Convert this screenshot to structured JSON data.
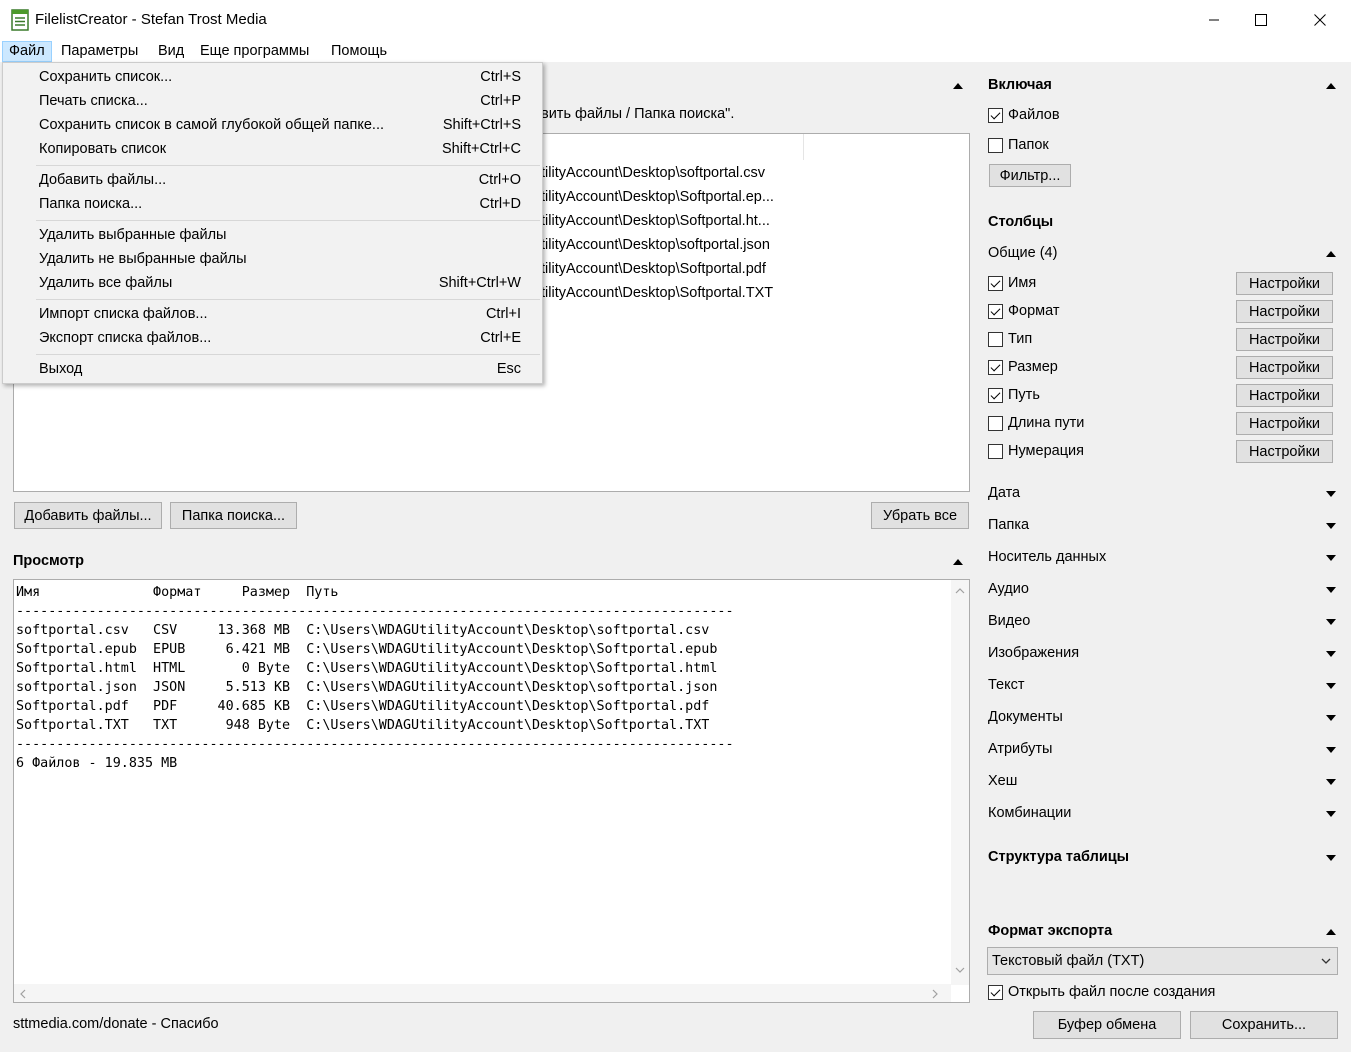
{
  "window": {
    "title": "FilelistCreator - Stefan Trost Media"
  },
  "menubar": [
    "Файл",
    "Параметры",
    "Вид",
    "Еще программы",
    "Помощь"
  ],
  "file_menu": {
    "groups": [
      [
        {
          "label": "Сохранить список...",
          "shortcut": "Ctrl+S"
        },
        {
          "label": "Печать списка...",
          "shortcut": "Ctrl+P"
        },
        {
          "label": "Сохранить список в самой глубокой общей папке...",
          "shortcut": "Shift+Ctrl+S"
        },
        {
          "label": "Копировать список",
          "shortcut": "Shift+Ctrl+C"
        }
      ],
      [
        {
          "label": "Добавить файлы...",
          "shortcut": "Ctrl+O"
        },
        {
          "label": "Папка поиска...",
          "shortcut": "Ctrl+D"
        }
      ],
      [
        {
          "label": "Удалить выбранные файлы",
          "shortcut": ""
        },
        {
          "label": "Удалить не выбранные файлы",
          "shortcut": ""
        },
        {
          "label": "Удалить все файлы",
          "shortcut": "Shift+Ctrl+W"
        }
      ],
      [
        {
          "label": "Импорт списка файлов...",
          "shortcut": "Ctrl+I"
        },
        {
          "label": "Экспорт списка файлов...",
          "shortcut": "Ctrl+E"
        }
      ],
      [
        {
          "label": "Выход",
          "shortcut": "Esc"
        }
      ]
    ]
  },
  "files_panel": {
    "hint_tail": "вить файлы / Папка поиска\".",
    "list_tails": [
      "tilityAccount\\Desktop\\softportal.csv",
      "tilityAccount\\Desktop\\Softportal.ep...",
      "tilityAccount\\Desktop\\Softportal.ht...",
      "tilityAccount\\Desktop\\softportal.json",
      "tilityAccount\\Desktop\\Softportal.pdf",
      "tilityAccount\\Desktop\\Softportal.TXT"
    ],
    "add_files_button": "Добавить файлы...",
    "search_folder_button": "Папка поиска...",
    "remove_all_button": "Убрать все"
  },
  "preview": {
    "title": "Просмотр",
    "lines": [
      "Имя              Формат     Размер  Путь",
      "-----------------------------------------------------------------------------------------",
      "softportal.csv   CSV     13.368 MB  C:\\Users\\WDAGUtilityAccount\\Desktop\\softportal.csv",
      "Softportal.epub  EPUB     6.421 MB  C:\\Users\\WDAGUtilityAccount\\Desktop\\Softportal.epub",
      "Softportal.html  HTML       0 Byte  C:\\Users\\WDAGUtilityAccount\\Desktop\\Softportal.html",
      "softportal.json  JSON     5.513 KB  C:\\Users\\WDAGUtilityAccount\\Desktop\\softportal.json",
      "Softportal.pdf   PDF     40.685 KB  C:\\Users\\WDAGUtilityAccount\\Desktop\\Softportal.pdf",
      "Softportal.TXT   TXT      948 Byte  C:\\Users\\WDAGUtilityAccount\\Desktop\\Softportal.TXT",
      "-----------------------------------------------------------------------------------------",
      "6 Файлов - 19.835 MB"
    ]
  },
  "status": {
    "donate": "sttmedia.com/donate - Спасибо"
  },
  "sidebar": {
    "include_title": "Включая",
    "include_files": {
      "label": "Файлов",
      "checked": true
    },
    "include_folders": {
      "label": "Папок",
      "checked": false
    },
    "filter_button": "Фильтр...",
    "columns_title": "Столбцы",
    "general_title": "Общие (4)",
    "settings_label": "Настройки",
    "columns": [
      {
        "label": "Имя",
        "checked": true
      },
      {
        "label": "Формат",
        "checked": true
      },
      {
        "label": "Тип",
        "checked": false
      },
      {
        "label": "Размер",
        "checked": true
      },
      {
        "label": "Путь",
        "checked": true
      },
      {
        "label": "Длина пути",
        "checked": false
      },
      {
        "label": "Нумерация",
        "checked": false
      }
    ],
    "categories": [
      "Дата",
      "Папка",
      "Носитель данных",
      "Аудио",
      "Видео",
      "Изображения",
      "Текст",
      "Документы",
      "Атрибуты",
      "Хеш",
      "Комбинации"
    ],
    "table_structure_title": "Структура таблицы",
    "export_title": "Формат экспорта",
    "export_format": "Текстовый файл (TXT)",
    "open_after": {
      "label": "Открыть файл после создания",
      "checked": true
    },
    "clipboard_button": "Буфер обмена",
    "save_button": "Сохранить..."
  }
}
